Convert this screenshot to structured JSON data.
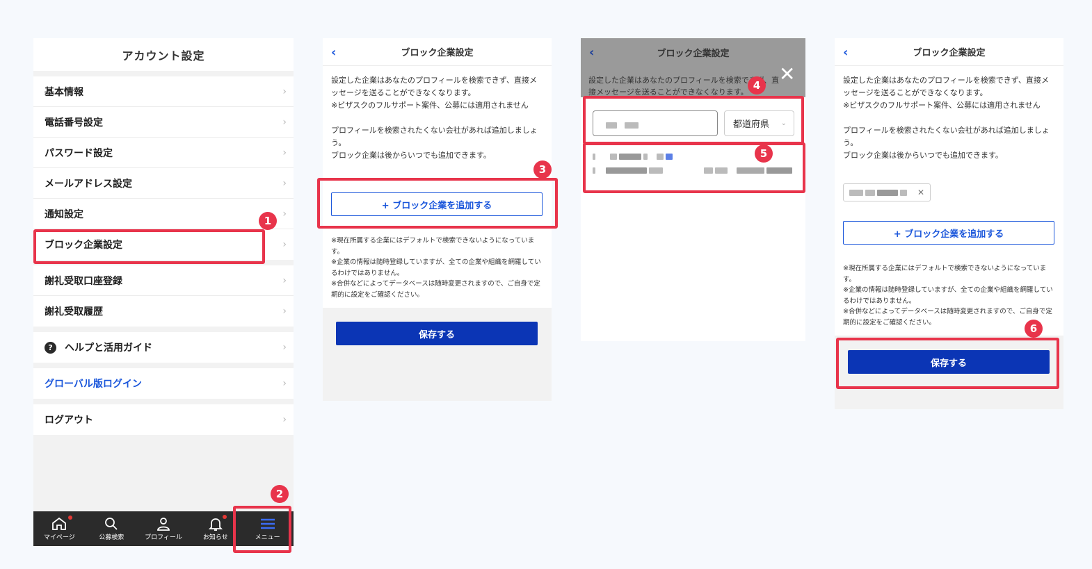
{
  "panel1": {
    "title": "アカウント設定",
    "group1": [
      "基本情報",
      "電話番号設定",
      "パスワード設定",
      "メールアドレス設定",
      "通知設定",
      "ブロック企業設定"
    ],
    "group2": [
      "謝礼受取口座登録",
      "謝礼受取履歴"
    ],
    "help": "ヘルプと活用ガイド",
    "global_login": "グローバル版ログイン",
    "logout": "ログアウト",
    "tabs": [
      "マイページ",
      "公募検索",
      "プロフィール",
      "お知らせ",
      "メニュー"
    ]
  },
  "block": {
    "title": "ブロック企業設定",
    "desc1": "設定した企業はあなたのプロフィールを検索できず、直接メッセージを送ることができなくなります。",
    "desc2": "※ビザスクのフルサポート案件、公募には適用されません",
    "desc3": "プロフィールを検索されたくない会社があれば追加しましょう。",
    "desc4": "ブロック企業は後からいつでも追加できます。",
    "add_button": "+ ブロック企業を追加する",
    "note1": "※現在所属する企業にはデフォルトで検索できないようになっています。",
    "note2": "※企業の情報は随時登録していますが、全ての企業や組織を網羅しているわけではありません。",
    "note3": "※合併などによってデータベースは随時変更されますので、ご自身で定期的に設定をご確認ください。",
    "save_button": "保存する",
    "overlay_line1": "設定した企業はあなたのプロフィールを検索できず、直",
    "overlay_line2": "接メッセージを送ることができなくなります。",
    "prefecture_placeholder": "都道府県"
  },
  "badges": [
    "1",
    "2",
    "3",
    "4",
    "5",
    "6"
  ],
  "colors": {
    "highlight": "#e8344b",
    "primary": "#0b35b5",
    "link": "#1a56db",
    "tabbar": "#2b2b2b"
  }
}
